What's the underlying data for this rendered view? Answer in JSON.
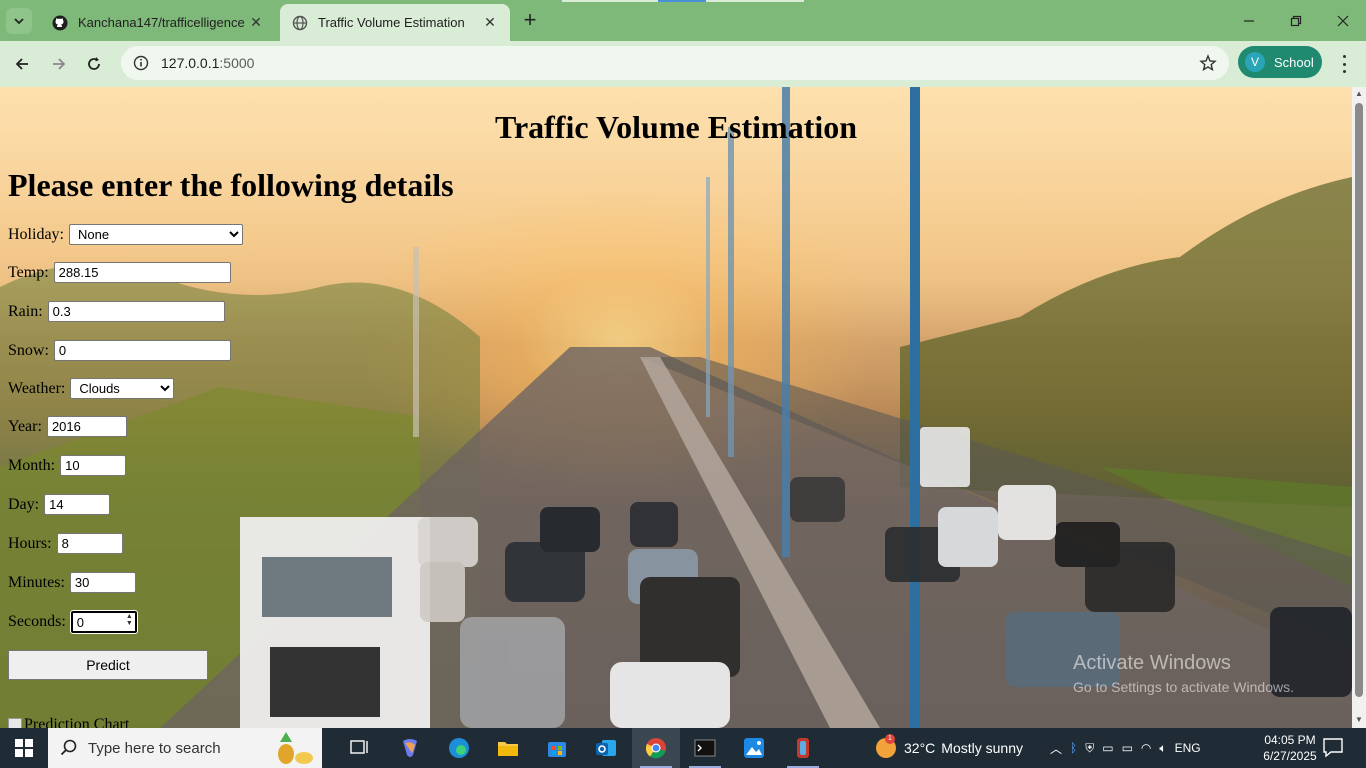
{
  "browser": {
    "tabs": [
      {
        "title": "Kanchana147/trafficelligence",
        "favicon": "github-icon"
      },
      {
        "title": "Traffic Volume Estimation",
        "favicon": "globe-icon"
      }
    ],
    "url_host": "127.0.0.1",
    "url_port": ":5000",
    "profile_initial": "V",
    "profile_name": "School"
  },
  "page": {
    "title": "Traffic Volume Estimation",
    "subtitle": "Please enter the following details",
    "fields": {
      "holiday": {
        "label": "Holiday:",
        "value": "None"
      },
      "temp": {
        "label": "Temp:",
        "value": "288.15"
      },
      "rain": {
        "label": "Rain:",
        "value": "0.3"
      },
      "snow": {
        "label": "Snow:",
        "value": "0"
      },
      "weather": {
        "label": "Weather:",
        "value": "Clouds"
      },
      "year": {
        "label": "Year:",
        "value": "2016"
      },
      "month": {
        "label": "Month:",
        "value": "10"
      },
      "day": {
        "label": "Day:",
        "value": "14"
      },
      "hours": {
        "label": "Hours:",
        "value": "8"
      },
      "minutes": {
        "label": "Minutes:",
        "value": "30"
      },
      "seconds": {
        "label": "Seconds:",
        "value": "0"
      }
    },
    "predict_label": "Predict",
    "chart_alt": "Prediction Chart"
  },
  "watermark": {
    "line1": "Activate Windows",
    "line2": "Go to Settings to activate Windows."
  },
  "taskbar": {
    "search_placeholder": "Type here to search",
    "weather_temp": "32°C",
    "weather_text": "Mostly sunny",
    "weather_badge": "1",
    "language": "ENG",
    "time": "04:05 PM",
    "date": "6/27/2025"
  },
  "colors": {
    "tabbar": "#7fb97a",
    "toolbar": "#d9ecd6",
    "profile": "#1f8a70",
    "taskbar": "#1f2b35"
  }
}
